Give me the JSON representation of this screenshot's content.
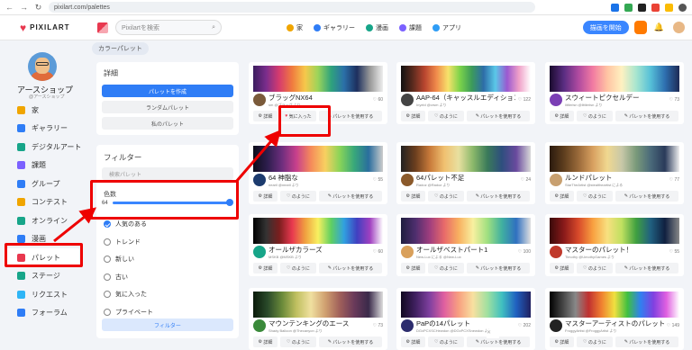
{
  "browser": {
    "url": "pixilart.com/palettes"
  },
  "header": {
    "logo": "PIXILART",
    "search_placeholder": "Pixilartを検索",
    "nav": [
      {
        "label": "家",
        "color": "#f0a500"
      },
      {
        "label": "ギャラリー",
        "color": "#2f7df6"
      },
      {
        "label": "漫画",
        "color": "#17a589"
      },
      {
        "label": "課題",
        "color": "#7b61ff"
      },
      {
        "label": "アプリ",
        "color": "#2f9df6"
      }
    ],
    "cta": "描画を開始"
  },
  "breadcrumb": "カラーパレット",
  "profile": {
    "name": "アースショップ",
    "sub": "@アースショップ"
  },
  "sidebar": [
    {
      "label": "家",
      "color": "#f0a500"
    },
    {
      "label": "ギャラリー",
      "color": "#2f7df6"
    },
    {
      "label": "デジタルアート",
      "color": "#17a589"
    },
    {
      "label": "課題",
      "color": "#7b61ff"
    },
    {
      "label": "グループ",
      "color": "#2f7df6"
    },
    {
      "label": "コンテスト",
      "color": "#f0a500"
    },
    {
      "label": "オンライン",
      "color": "#17a589"
    },
    {
      "label": "漫画",
      "color": "#2f7df6"
    },
    {
      "label": "パレット",
      "color": "#e8384f"
    },
    {
      "label": "ステージ",
      "color": "#17a589"
    },
    {
      "label": "リクエスト",
      "color": "#2fb5f6"
    },
    {
      "label": "フォーラム",
      "color": "#2f7df6"
    }
  ],
  "details": {
    "title": "詳細",
    "create": "パレットを作成",
    "random": "ランダムパレット",
    "mine": "私のパレット"
  },
  "filter": {
    "title": "フィルター",
    "search_placeholder": "検索パレット",
    "colors_label": "色数",
    "colors_value": "64",
    "options": [
      "人気のある",
      "トレンド",
      "新しい",
      "古い",
      "気に入った",
      "プライベート"
    ],
    "selected": 0,
    "button": "フィルター"
  },
  "card_buttons": {
    "detail": "詳細",
    "like": "のように",
    "liked": "気に入った",
    "use": "パレットを使用する"
  },
  "palettes": [
    {
      "title": "ブラッグNX64",
      "author": "sm @ブラッグ より",
      "likes": "60",
      "avatar": "#7a5a3a"
    },
    {
      "title": "AAP-64（キャッスルエディション）",
      "author": "Inyeld @crsm より",
      "likes": "122",
      "avatar": "#444"
    },
    {
      "title": "スウィートピクセルデー",
      "author": "littlerisn @littlerisn より",
      "likes": "73",
      "avatar": "#7b3fb5"
    },
    {
      "title": "64 神脂な",
      "author": "nearil @nearil より",
      "likes": "55",
      "avatar": "#1d3b6e"
    },
    {
      "title": "64パレット不足",
      "author": "Radoz @Radoz より",
      "likes": "24",
      "avatar": "#8b5a2b"
    },
    {
      "title": "ルンドパレット",
      "author": "StarTheArtist @stealtheartist による",
      "likes": "77",
      "avatar": "#c8a070"
    },
    {
      "title": "オールザカラーズ",
      "author": "MSKB @MSKB より",
      "likes": "60",
      "avatar": "#17a589"
    },
    {
      "title": "オールザベストパート1",
      "author": "New-Lux による @New-Lux",
      "likes": "100",
      "avatar": "#d9a05b"
    },
    {
      "title": "マスターのパレット！",
      "author": "Timothy @UmothyGames より",
      "likes": "55",
      "avatar": "#c0392b"
    },
    {
      "title": "マウンテンキングのエース",
      "author": "Shady Balloon @Thecanyon より",
      "likes": "73",
      "avatar": "#3a8a3a"
    },
    {
      "title": "PaPの14パレット",
      "author": "DGxPCXSCHewdon @DGxPCXSnewdon より",
      "likes": "202",
      "avatar": "#2d2d6e"
    },
    {
      "title": "マスターアーティストのパレット",
      "author": "FroggyArtist @FroggyArtist より",
      "likes": "149",
      "avatar": "#222"
    }
  ]
}
